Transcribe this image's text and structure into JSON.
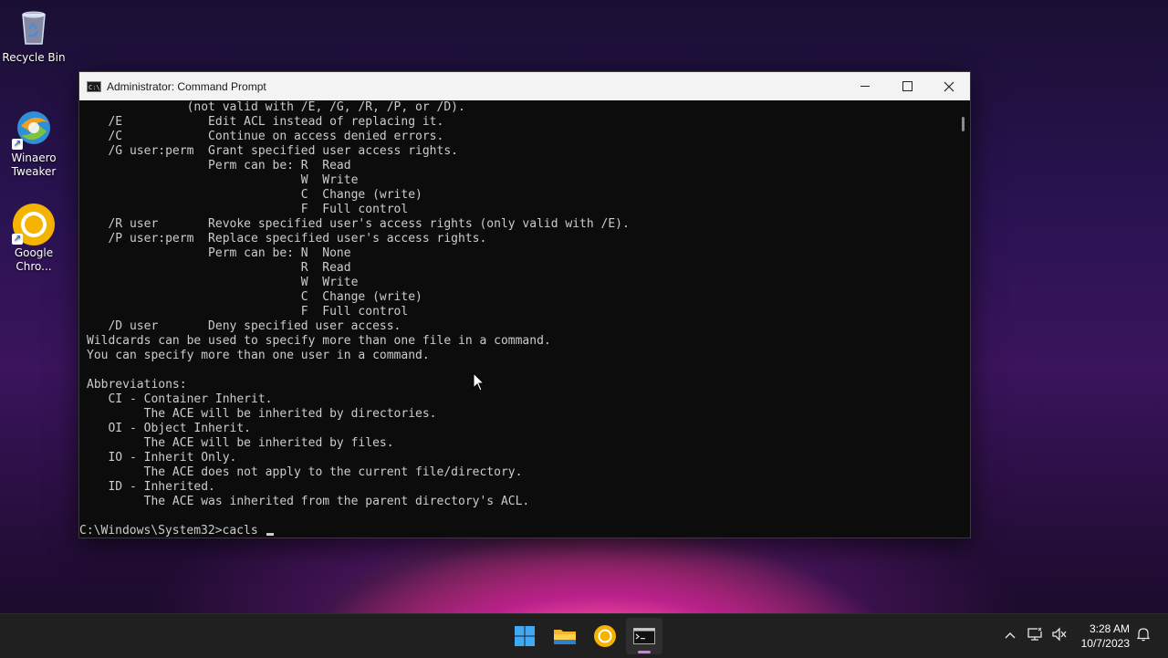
{
  "desktop": {
    "icons": [
      {
        "label": "Recycle Bin",
        "icon": "recycle-bin-icon"
      },
      {
        "label": "Winaero\nTweaker",
        "label_line1": "Winaero",
        "label_line2": "Tweaker",
        "icon": "winaero-tweaker-icon"
      },
      {
        "label_line1": "Google",
        "label_line2": "Chro...",
        "icon": "google-chrome-icon"
      }
    ]
  },
  "window": {
    "title": "Administrator: Command Prompt",
    "controls": [
      "minimize-icon",
      "maximize-icon",
      "close-icon"
    ]
  },
  "console": {
    "lines": [
      "              (not valid with /E, /G, /R, /P, or /D).",
      "   /E            Edit ACL instead of replacing it.",
      "   /C            Continue on access denied errors.",
      "   /G user:perm  Grant specified user access rights.",
      "                 Perm can be: R  Read",
      "                              W  Write",
      "                              C  Change (write)",
      "                              F  Full control",
      "   /R user       Revoke specified user's access rights (only valid with /E).",
      "   /P user:perm  Replace specified user's access rights.",
      "                 Perm can be: N  None",
      "                              R  Read",
      "                              W  Write",
      "                              C  Change (write)",
      "                              F  Full control",
      "   /D user       Deny specified user access.",
      "Wildcards can be used to specify more than one file in a command.",
      "You can specify more than one user in a command.",
      "",
      "Abbreviations:",
      "   CI - Container Inherit.",
      "        The ACE will be inherited by directories.",
      "   OI - Object Inherit.",
      "        The ACE will be inherited by files.",
      "   IO - Inherit Only.",
      "        The ACE does not apply to the current file/directory.",
      "   ID - Inherited.",
      "        The ACE was inherited from the parent directory's ACL.",
      ""
    ],
    "prompt": "C:\\Windows\\System32>cacls "
  },
  "taskbar": {
    "apps": [
      "windows-start-icon",
      "file-explorer-icon",
      "google-chrome-icon",
      "command-prompt-icon"
    ],
    "tray": [
      "chevron-up-icon",
      "network-icon",
      "volume-muted-icon"
    ],
    "time": "3:28 AM",
    "date": "10/7/2023",
    "notification_icon": "notification-icon"
  },
  "colors": {
    "console_bg": "#0c0c0c",
    "console_fg": "#cccccc",
    "titlebar_bg": "#f3f3f3",
    "taskbar_bg": "#202020",
    "active_indicator": "#d27ae6"
  }
}
